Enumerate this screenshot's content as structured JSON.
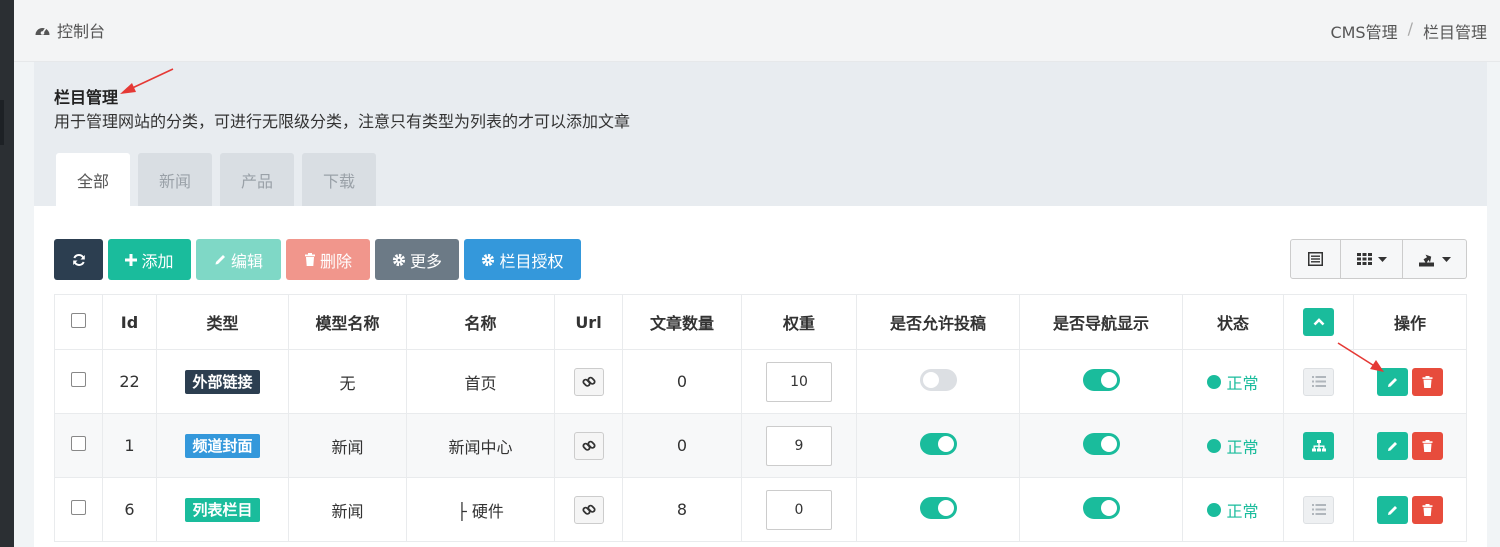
{
  "topbar": {
    "dashboard_label": "控制台",
    "breadcrumb": [
      "CMS管理",
      "栏目管理"
    ],
    "breadcrumb_sep": "/"
  },
  "panel": {
    "title": "栏目管理",
    "description": "用于管理网站的分类，可进行无限级分类，注意只有类型为列表的才可以添加文章",
    "tabs": [
      "全部",
      "新闻",
      "产品",
      "下载"
    ]
  },
  "toolbar": {
    "add_label": "添加",
    "edit_label": "编辑",
    "delete_label": "删除",
    "more_label": "更多",
    "auth_label": "栏目授权"
  },
  "table": {
    "headers": [
      "Id",
      "类型",
      "模型名称",
      "名称",
      "Url",
      "文章数量",
      "权重",
      "是否允许投稿",
      "是否导航显示",
      "状态",
      "操作"
    ],
    "rows": [
      {
        "id": "22",
        "type": "外部链接",
        "type_color": "#2c3e50",
        "model": "无",
        "name": "首页",
        "articles": "0",
        "weight": "10",
        "allow_submit": false,
        "nav_show": true,
        "status": "正常",
        "tree": "list"
      },
      {
        "id": "1",
        "type": "频道封面",
        "type_color": "#3498db",
        "model": "新闻",
        "name": "新闻中心",
        "articles": "0",
        "weight": "9",
        "allow_submit": true,
        "nav_show": true,
        "status": "正常",
        "tree": "sitemap"
      },
      {
        "id": "6",
        "type": "列表栏目",
        "type_color": "#1abc9c",
        "model": "新闻",
        "name": "├ 硬件",
        "articles": "8",
        "weight": "0",
        "allow_submit": true,
        "nav_show": true,
        "status": "正常",
        "tree": "list"
      }
    ]
  },
  "colors": {
    "primary": "#1abc9c",
    "info": "#3498db",
    "danger": "#e74c3c",
    "dark": "#2c3e50",
    "annotation_arrow": "#e53935"
  }
}
